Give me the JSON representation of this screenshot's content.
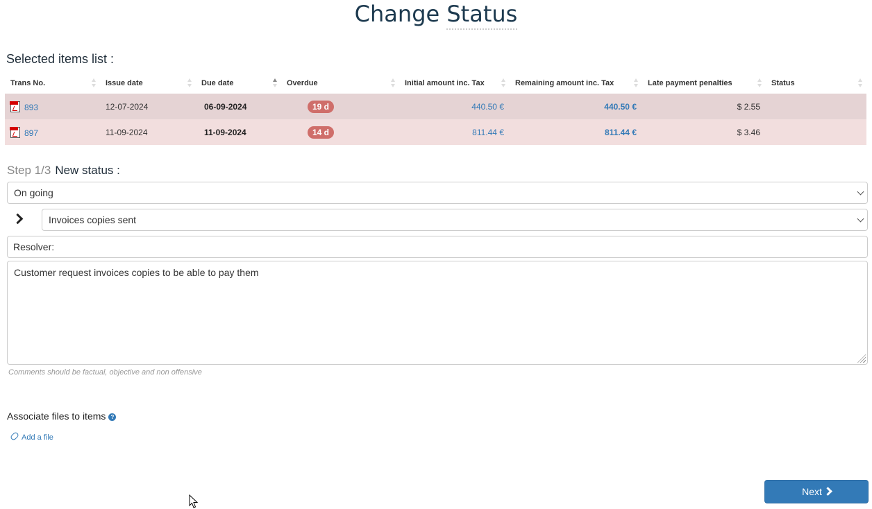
{
  "page": {
    "title_part1": "Change",
    "title_part2": "Status"
  },
  "selected_items": {
    "heading": "Selected items list :",
    "columns": [
      {
        "label": "Trans No.",
        "sort": "none"
      },
      {
        "label": "Issue date",
        "sort": "none"
      },
      {
        "label": "Due date",
        "sort": "asc"
      },
      {
        "label": "Overdue",
        "sort": "none"
      },
      {
        "label": "Initial amount inc. Tax",
        "sort": "none"
      },
      {
        "label": "Remaining amount inc. Tax",
        "sort": "none"
      },
      {
        "label": "Late payment penalties",
        "sort": "none"
      },
      {
        "label": "Status",
        "sort": "none"
      }
    ],
    "rows": [
      {
        "trans_no": "893",
        "issue_date": "12-07-2024",
        "due_date": "06-09-2024",
        "overdue": "19 d",
        "initial_amount": "440.50 €",
        "remaining_amount": "440.50 €",
        "penalties": "$ 2.55",
        "status": ""
      },
      {
        "trans_no": "897",
        "issue_date": "11-09-2024",
        "due_date": "11-09-2024",
        "overdue": "14 d",
        "initial_amount": "811.44 €",
        "remaining_amount": "811.44 €",
        "penalties": "$ 3.46",
        "status": ""
      }
    ]
  },
  "form": {
    "step": "Step 1/3",
    "step_label": "New status :",
    "status_value": "On going",
    "substatus_value": "Invoices copies sent",
    "resolver_placeholder": "Resolver:",
    "comment_value": "Customer request invoices copies to be able to pay them",
    "comment_hint": "Comments should be factual, objective and non offensive"
  },
  "files": {
    "heading": "Associate files to items",
    "help_glyph": "?",
    "add_file_label": "Add a file"
  },
  "actions": {
    "next_label": "Next"
  }
}
